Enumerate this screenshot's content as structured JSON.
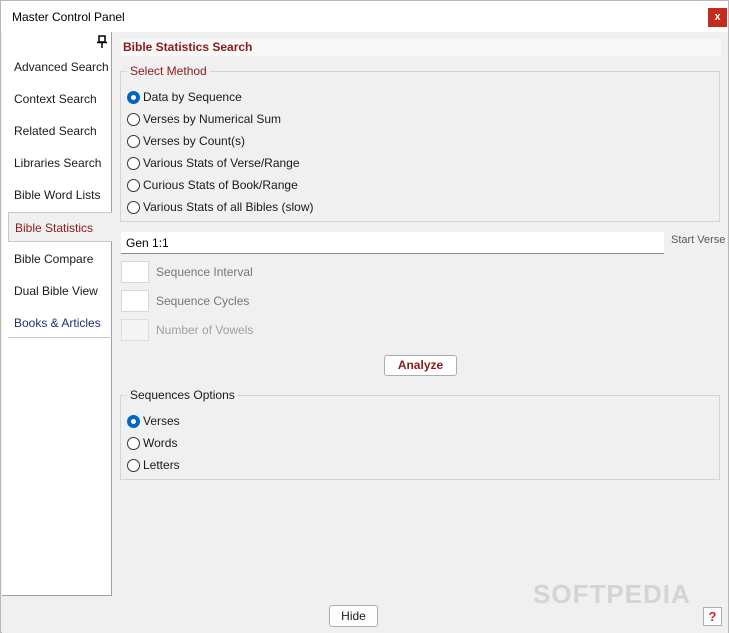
{
  "window": {
    "title": "Master Control Panel",
    "close_label": "x"
  },
  "sidebar": {
    "items": [
      {
        "label": "Advanced Search"
      },
      {
        "label": "Context Search"
      },
      {
        "label": "Related Search"
      },
      {
        "label": "Libraries Search"
      },
      {
        "label": "Bible Word Lists"
      },
      {
        "label": "Bible Statistics",
        "active": true
      },
      {
        "label": "Bible Compare"
      },
      {
        "label": "Dual Bible View"
      },
      {
        "label": "Books & Articles"
      }
    ]
  },
  "main": {
    "section_title": "Bible Statistics Search",
    "select_method": {
      "label": "Select Method",
      "selected": "Data by Sequence",
      "options": [
        "Data by Sequence",
        "Verses by Numerical Sum",
        "Verses by Count(s)",
        "Various Stats of Verse/Range",
        "Curious Stats of Book/Range",
        "Various Stats of all Bibles (slow)"
      ]
    },
    "start_verse": {
      "value": "Gen 1:1",
      "label": "Start Verse"
    },
    "sequence_interval": {
      "label": "Sequence Interval",
      "value": ""
    },
    "sequence_cycles": {
      "label": "Sequence Cycles",
      "value": ""
    },
    "number_of_vowels": {
      "label": "Number of Vowels",
      "value": ""
    },
    "analyze_label": "Analyze",
    "sequence_options": {
      "label": "Sequences Options",
      "selected": "Verses",
      "options": [
        "Verses",
        "Words",
        "Letters"
      ]
    }
  },
  "footer": {
    "hide_label": "Hide",
    "help_label": "?"
  },
  "watermark": "SOFTPEDIA"
}
